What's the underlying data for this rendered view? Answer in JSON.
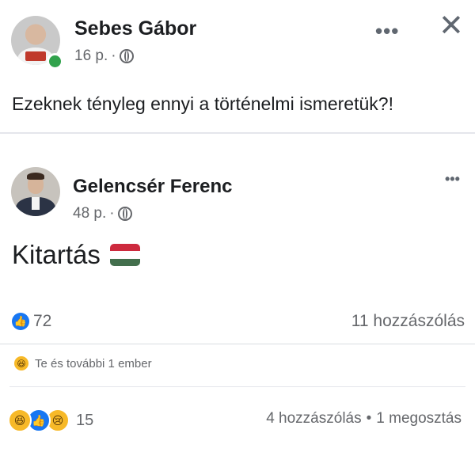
{
  "post": {
    "author": "Sebes Gábor",
    "time": "16 p.",
    "separator": "·",
    "text": "Ezeknek tényleg ennyi a történelmi ismeretük?!",
    "more_symbol": "•••",
    "close_symbol": "✕"
  },
  "shared": {
    "author": "Gelencsér Ferenc",
    "time": "48 p.",
    "separator": "·",
    "text": "Kitartás",
    "more_symbol": "•••",
    "likes_count": "72",
    "comments": "11 hozzászólás",
    "flag_colors": [
      "#cd2a3e",
      "#ffffff",
      "#436f4d"
    ]
  },
  "reacted": {
    "label": "Te és további 1 ember"
  },
  "footer": {
    "reaction_count": "15",
    "comments": "4 hozzászólás",
    "dot": "•",
    "shares": "1 megosztás"
  },
  "colors": {
    "like_blue": "#1877f2",
    "emoji_yellow": "#f7b928",
    "online_green": "#31a24c",
    "meta_gray": "#65676b"
  }
}
